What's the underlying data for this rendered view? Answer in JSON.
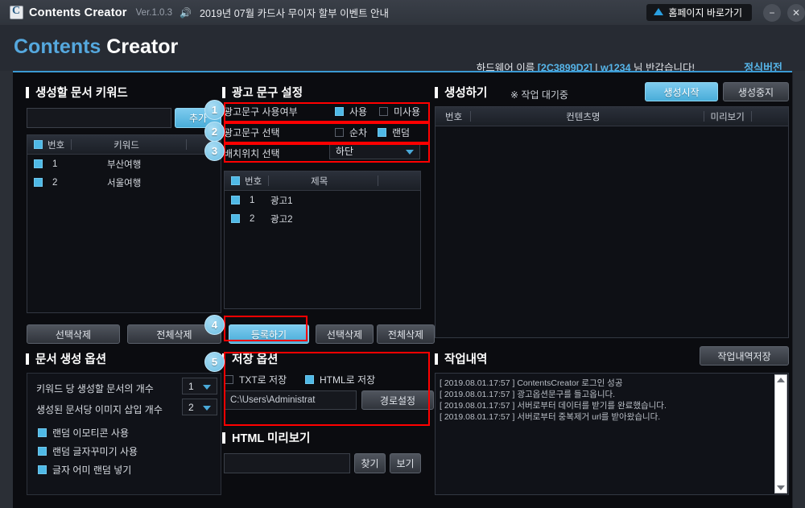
{
  "titlebar": {
    "logo_icon": "app-logo-icon",
    "app_title": "Contents Creator",
    "version": "Ver.1.0.3",
    "speaker_icon": "speaker-icon",
    "notice": "2019년 07월 카드사 무이자 할부 이벤트 안내",
    "home_button": "홈페이지 바로가기",
    "home_icon": "home-icon",
    "minimize": "−",
    "close": "✕"
  },
  "header": {
    "brand_part1": "Contents",
    "brand_part2": "Creator",
    "hw_label": "하드웨어 이름",
    "hw_id": "[2C3899D2]",
    "separator": "|",
    "user": "w1234",
    "greeting": "님 반갑습니다!",
    "license": "정식버전",
    "accent_color": "#55a8de"
  },
  "keywords_panel": {
    "title": "생성할 문서 키워드",
    "input_value": "",
    "add_button": "추가",
    "columns": [
      "번호",
      "키워드"
    ],
    "rows": [
      {
        "checked": true,
        "no": "1",
        "keyword": "부산여행"
      },
      {
        "checked": true,
        "no": "2",
        "keyword": "서울여행"
      }
    ],
    "delete_selected": "선택삭제",
    "delete_all": "전체삭제"
  },
  "doc_options_panel": {
    "title": "문서 생성 옵션",
    "opt1_label": "키워드 당 생성할 문서의 개수",
    "opt1_value": "1",
    "opt2_label": "생성된 문서당 이미지 삽입 개수",
    "opt2_value": "2",
    "checks": [
      {
        "label": "랜덤 이모티콘 사용",
        "checked": true
      },
      {
        "label": "랜덤 글자꾸미기 사용",
        "checked": true
      },
      {
        "label": "글자 어미 랜덤 넣기",
        "checked": true
      }
    ]
  },
  "ad_panel": {
    "title": "광고 문구 설정",
    "row1_label": "광고문구 사용여부",
    "row1_opt1": "사용",
    "row1_opt1_checked": true,
    "row1_opt2": "미사용",
    "row1_opt2_checked": false,
    "row2_label": "광고문구 선택",
    "row2_opt1": "순차",
    "row2_opt1_checked": false,
    "row2_opt2": "랜덤",
    "row2_opt2_checked": true,
    "row3_label": "배치위치 선택",
    "row3_value": "하단",
    "columns": [
      "번호",
      "제목"
    ],
    "rows": [
      {
        "checked": true,
        "no": "1",
        "title": "광고1"
      },
      {
        "checked": true,
        "no": "2",
        "title": "광고2"
      }
    ],
    "register_button": "등록하기",
    "delete_selected": "선택삭제",
    "delete_all": "전체삭제"
  },
  "save_panel": {
    "title": "저장 옵션",
    "txt_label": "TXT로 저장",
    "txt_checked": false,
    "html_label": "HTML로 저장",
    "html_checked": true,
    "path_value": "C:\\Users\\Administrat",
    "path_button": "경로설정"
  },
  "preview_panel": {
    "title": "HTML 미리보기",
    "input_value": "",
    "find_button": "찾기",
    "view_button": "보기"
  },
  "generate_panel": {
    "title": "생성하기",
    "status_icon": "※",
    "status": "작업 대기중",
    "start_button": "생성시작",
    "stop_button": "생성중지",
    "columns": [
      "번호",
      "컨텐츠명",
      "미리보기"
    ],
    "rows": []
  },
  "log_panel": {
    "title": "작업내역",
    "save_button": "작업내역저장",
    "lines": [
      "[ 2019.08.01.17:57 ] ContentsCreator 로그인 성공",
      "[ 2019.08.01.17:57 ] 광고옵션문구를 들고옵니다.",
      "[ 2019.08.01.17:57 ] 서버로부터 데이터를 받기를 완료했습니다.",
      "[ 2019.08.01.17:57 ] 서버로부터 중복제거 url를 받아왔습니다."
    ],
    "scroll_up_icon": "scroll-up-icon",
    "scroll_down_icon": "scroll-down-icon"
  },
  "annotations": {
    "badges": [
      "1",
      "2",
      "3",
      "4",
      "5"
    ],
    "highlight_color": "#ff0000"
  }
}
